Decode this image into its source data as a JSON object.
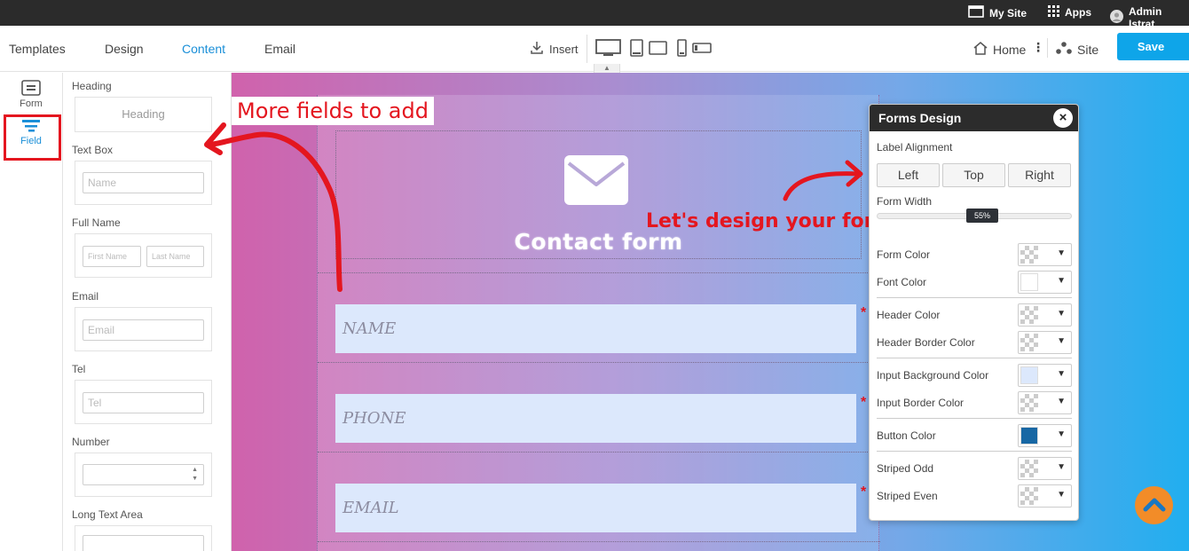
{
  "topbar": {
    "my_site": "My Site",
    "apps": "Apps",
    "admin": "Admin Istrat"
  },
  "toolbar": {
    "tabs": [
      "Templates",
      "Design",
      "Content",
      "Email"
    ],
    "active_tab": "Content",
    "insert": "Insert",
    "home": "Home",
    "site": "Site",
    "save": "Save"
  },
  "rail": {
    "items": [
      {
        "label": "Form",
        "icon": "form-icon"
      },
      {
        "label": "Field",
        "icon": "field-icon"
      }
    ],
    "active": "Field"
  },
  "fields_panel": {
    "heading": {
      "label": "Heading",
      "preview": "Heading"
    },
    "text_box": {
      "label": "Text Box",
      "placeholder": "Name"
    },
    "full_name": {
      "label": "Full Name",
      "first": "First Name",
      "last": "Last Name"
    },
    "email": {
      "label": "Email",
      "placeholder": "Email"
    },
    "tel": {
      "label": "Tel",
      "placeholder": "Tel"
    },
    "number": {
      "label": "Number",
      "placeholder": ""
    },
    "long_text": {
      "label": "Long Text Area",
      "placeholder": ""
    }
  },
  "form": {
    "title": "Contact form",
    "fields": [
      {
        "placeholder": "NAME",
        "required": "*"
      },
      {
        "placeholder": "PHONE",
        "required": "*"
      },
      {
        "placeholder": "EMAIL",
        "required": "*"
      }
    ]
  },
  "annotations": {
    "more_fields": "More fields to add",
    "design_form": "Let's design your form"
  },
  "forms_design": {
    "title": "Forms Design",
    "label_alignment": "Label Alignment",
    "align_options": [
      "Left",
      "Top",
      "Right"
    ],
    "form_width_label": "Form Width",
    "form_width_value": "55%",
    "form_width_fraction": 0.55,
    "colors": [
      {
        "label": "Form Color",
        "swatch": "transparent"
      },
      {
        "label": "Font Color",
        "swatch": "#ffffff"
      },
      {
        "label": "Header Color",
        "swatch": "transparent"
      },
      {
        "label": "Header Border Color",
        "swatch": "transparent"
      },
      {
        "label": "Input Background Color",
        "swatch": "#dce8fc"
      },
      {
        "label": "Input Border Color",
        "swatch": "transparent"
      },
      {
        "label": "Button Color",
        "swatch": "#1767a4"
      },
      {
        "label": "Striped Odd",
        "swatch": "transparent"
      },
      {
        "label": "Striped Even",
        "swatch": "transparent"
      }
    ]
  },
  "colors": {
    "accent": "#1a8fd8",
    "save": "#0ea5e9",
    "annotation": "#e4161f",
    "scroll_top": "#f28c28"
  }
}
